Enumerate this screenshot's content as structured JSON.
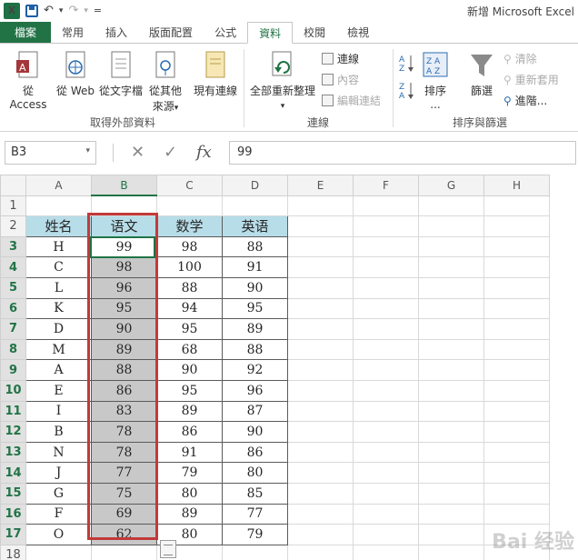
{
  "window": {
    "title": "新增 Microsoft Excel"
  },
  "qat": {
    "excel_icon": "X",
    "undo_icon": "↶",
    "redo_icon": "↷",
    "customize_icon": "=",
    "dropdown": "▾"
  },
  "tabs": [
    "檔案",
    "常用",
    "插入",
    "版面配置",
    "公式",
    "資料",
    "校閱",
    "檢視"
  ],
  "active_tab": "資料",
  "ribbon": {
    "get_external": {
      "label": "取得外部資料",
      "buttons": [
        "從 Access",
        "從 Web",
        "從文字檔",
        "從其他",
        "來源",
        "▾",
        "現有連線"
      ]
    },
    "connections": {
      "label": "連線",
      "refresh_all": "全部重新整理",
      "refresh_arrow": "▾",
      "small": [
        "連線",
        "內容",
        "編輯連結"
      ]
    },
    "sort_filter": {
      "label": "排序與篩選",
      "sort": "排序",
      "sort_dots": "...",
      "filter": "篩選",
      "small": [
        "清除",
        "重新套用",
        "進階..."
      ]
    }
  },
  "formula_bar": {
    "name_box": "B3",
    "name_box_arrow": "▾",
    "cancel": "✕",
    "enter": "✓",
    "fx": "fx",
    "value": "99"
  },
  "sheet": {
    "columns": [
      "A",
      "B",
      "C",
      "D",
      "E",
      "F",
      "G",
      "H"
    ],
    "rows": [
      "1",
      "2",
      "3",
      "4",
      "5",
      "6",
      "7",
      "8",
      "9",
      "10",
      "11",
      "12",
      "13",
      "14",
      "15",
      "16",
      "17",
      "18"
    ],
    "header_row": [
      "姓名",
      "语文",
      "数学",
      "英语"
    ],
    "data": [
      [
        "H",
        "99",
        "98",
        "88"
      ],
      [
        "C",
        "98",
        "100",
        "91"
      ],
      [
        "L",
        "96",
        "88",
        "90"
      ],
      [
        "K",
        "95",
        "94",
        "95"
      ],
      [
        "D",
        "90",
        "95",
        "89"
      ],
      [
        "M",
        "89",
        "68",
        "88"
      ],
      [
        "A",
        "88",
        "90",
        "92"
      ],
      [
        "E",
        "86",
        "95",
        "96"
      ],
      [
        "I",
        "83",
        "89",
        "87"
      ],
      [
        "B",
        "78",
        "86",
        "90"
      ],
      [
        "N",
        "78",
        "91",
        "86"
      ],
      [
        "J",
        "77",
        "79",
        "80"
      ],
      [
        "G",
        "75",
        "80",
        "85"
      ],
      [
        "F",
        "69",
        "89",
        "77"
      ],
      [
        "O",
        "62",
        "80",
        "79"
      ]
    ]
  },
  "colors": {
    "accent": "#217346",
    "header_fill": "#b7dde8",
    "highlight_fill": "#c8c8c8",
    "annotation_box": "#c23a3a"
  },
  "watermark": "Bai 经验"
}
